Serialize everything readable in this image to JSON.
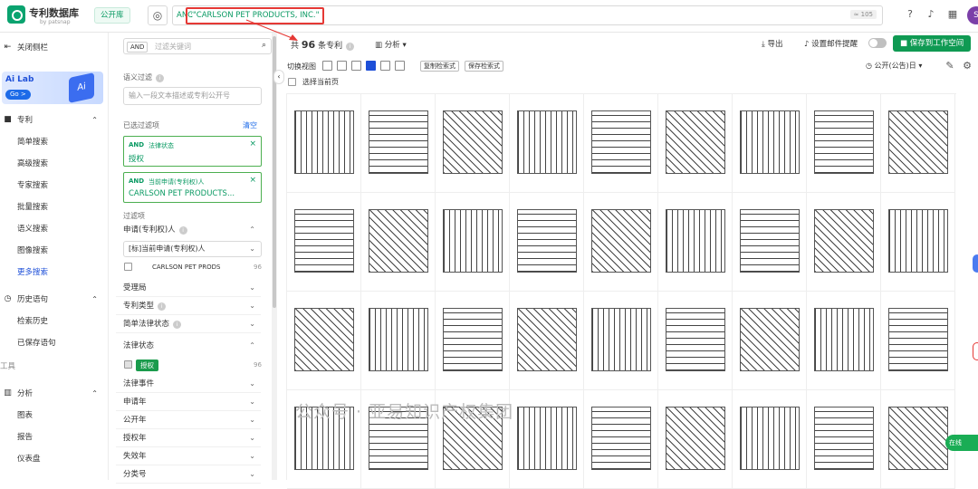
{
  "header": {
    "brand": "专利数据库",
    "brand_sub": "by patsnap",
    "library": "公开库",
    "query_prefix": "ANC",
    "query": ":\"CARLSON PET PRODUCTS, INC.\"",
    "query_count": "≈ 105",
    "avatar": "S",
    "colors": {
      "accent": "#0a9a63",
      "highlight": "#e53935",
      "primary": "#1d4fd8"
    }
  },
  "nav": {
    "collapse": "关闭侧栏",
    "ailab": {
      "title": "Ai Lab",
      "go": "Go >"
    },
    "patent_section": "专利",
    "patent_items": [
      "简单搜索",
      "高级搜索",
      "专家搜索",
      "批量搜索",
      "语义搜索",
      "图像搜索",
      "更多搜索"
    ],
    "history_section": "历史语句",
    "history_items": [
      "检索历史",
      "已保存语句"
    ],
    "tools_label": "工具",
    "analysis_section": "分析",
    "analysis_items": [
      "图表",
      "报告",
      "仪表盘"
    ]
  },
  "filters": {
    "and_tag": "AND",
    "search_placeholder": "过滤关键词",
    "semantic_label": "语义过滤",
    "semantic_placeholder": "输入一段文本描述或专利公开号",
    "selected_label": "已选过滤项",
    "clear": "清空",
    "chips": [
      {
        "and": "AND",
        "field": "法律状态",
        "value": "授权"
      },
      {
        "and": "AND",
        "field": "当前申请(专利权)人",
        "value": "CARLSON PET PRODUCTS..."
      }
    ],
    "filter_label": "过滤项",
    "applicant_header": "申请(专利权)人",
    "applicant_select": "[标]当前申请(专利权)人",
    "applicant_option": {
      "label": "CARLSON PET PRODS",
      "count": "96"
    },
    "rows": [
      "受理局",
      "专利类型",
      "简单法律状态",
      "法律状态"
    ],
    "legal_granted": {
      "label": "授权",
      "count": "96"
    },
    "rows2": [
      "法律事件",
      "申请年",
      "公开年",
      "授权年",
      "失效年",
      "分类号"
    ]
  },
  "toolbar": {
    "total_prefix": "共",
    "total": "96",
    "total_suffix": "条专利",
    "analysis": "分析",
    "export": "导出",
    "mail": "设置邮件提醒",
    "save": "保存到工作空间",
    "switch_view": "切换视图",
    "copy_query": "复制检索式",
    "save_query": "保存检索式",
    "pub_date": "公开(公告)日",
    "select_page": "选择当前页"
  },
  "watermark": "公众号 · 亚易知识产权集团",
  "chat": "在线"
}
